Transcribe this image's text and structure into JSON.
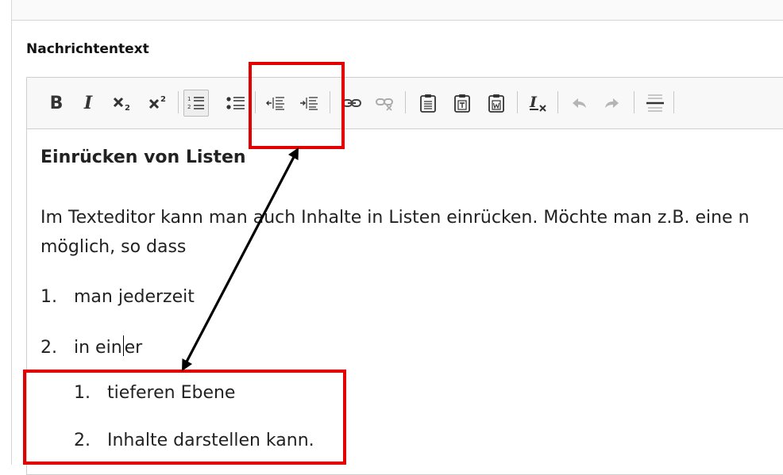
{
  "field": {
    "label": "Nachrichtentext"
  },
  "toolbar": {
    "bold": "B",
    "italic": "I",
    "subscript_label": "Tiefgestellt",
    "superscript_label": "Hochgestellt"
  },
  "content": {
    "heading": "Einrücken von Listen",
    "paragraph_line1": "Im Texteditor kann man auch Inhalte in Listen einrücken.  Möchte man z.B. eine n",
    "paragraph_line2": "möglich, so dass",
    "list": [
      {
        "num": "1.",
        "text": "man jederzeit"
      },
      {
        "num": "2.",
        "text_before_caret": "in ein",
        "text_after_caret": "er"
      }
    ],
    "sublist": [
      {
        "num": "1.",
        "text": "tieferen Ebene"
      },
      {
        "num": "2.",
        "text": "Inhalte darstellen kann."
      }
    ]
  },
  "annotation": {
    "color": "#e30000",
    "arrow_color": "#000000"
  }
}
